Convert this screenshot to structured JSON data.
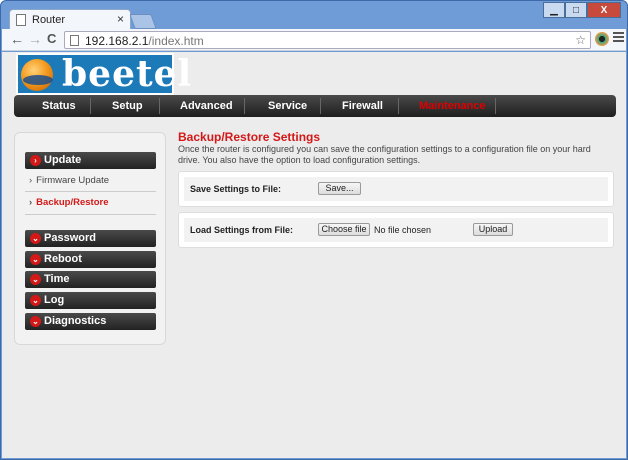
{
  "browser": {
    "tab_title": "Router",
    "tab_close": "×",
    "url_host": "192.168.2.1",
    "url_path": "/index.htm",
    "back": "←",
    "forward": "→",
    "reload": "C",
    "minimize": "▁",
    "maximize": "□",
    "close": "X"
  },
  "logo": {
    "text": "beetel"
  },
  "mainnav": {
    "items": [
      "Status",
      "Setup",
      "Advanced",
      "Service",
      "Firewall",
      "Maintenance"
    ],
    "active": "Maintenance"
  },
  "sidebar": {
    "update": "Update",
    "firmware_update": "Firmware Update",
    "backup_restore": "Backup/Restore",
    "password": "Password",
    "reboot": "Reboot",
    "time": "Time",
    "log": "Log",
    "diagnostics": "Diagnostics"
  },
  "content": {
    "title": "Backup/Restore Settings",
    "description": "Once the router is configured you can save the configuration settings to a configuration file on your hard drive. You also have the option to load configuration settings.",
    "save_label": "Save Settings to File:",
    "save_button": "Save...",
    "load_label": "Load Settings from File:",
    "choose_file_button": "Choose file",
    "file_status": "No file chosen",
    "upload_button": "Upload"
  },
  "colors": {
    "accent": "#d31818",
    "nav_bg": "#2a2a2a",
    "logo_bg": "#1d7ab8"
  }
}
